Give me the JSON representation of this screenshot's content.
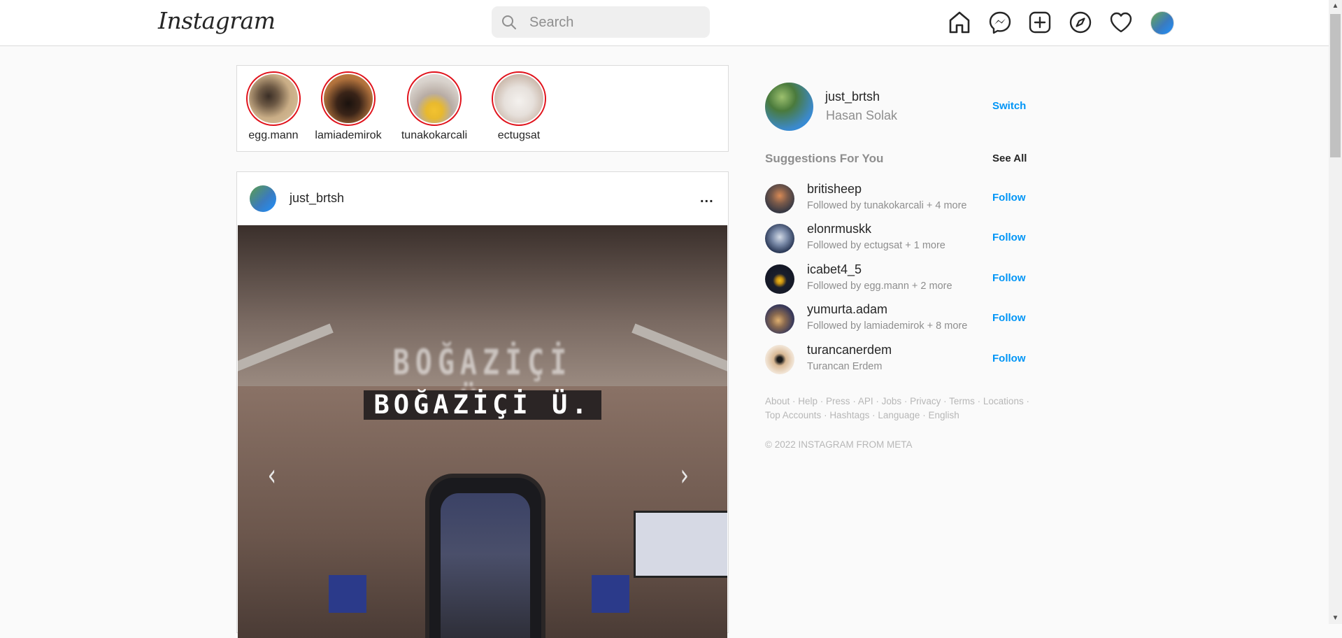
{
  "app": {
    "logo_text": "Instagram"
  },
  "search": {
    "placeholder": "Search",
    "value": ""
  },
  "nav": {
    "icons": [
      "home-icon",
      "messenger-icon",
      "new-post-icon",
      "explore-icon",
      "activity-heart-icon",
      "profile-avatar"
    ]
  },
  "stories": [
    {
      "username": "egg.mann"
    },
    {
      "username": "lamiademirok"
    },
    {
      "username": "tunakokarcali"
    },
    {
      "username": "ectugsat"
    }
  ],
  "post": {
    "username": "just_brtsh",
    "more_label": "...",
    "image_sign_text": "BOĞAZİÇİ Ü.",
    "prev_arrow": "‹",
    "next_arrow": "›"
  },
  "profile": {
    "username": "just_brtsh",
    "full_name": "Hasan Solak",
    "switch_label": "Switch"
  },
  "suggestions": {
    "title": "Suggestions For You",
    "see_all_label": "See All",
    "follow_label": "Follow",
    "items": [
      {
        "username": "britisheep",
        "subtitle": "Followed by tunakokarcali + 4 more"
      },
      {
        "username": "elonrmuskk",
        "subtitle": "Followed by ectugsat + 1 more"
      },
      {
        "username": "icabet4_5",
        "subtitle": "Followed by egg.mann + 2 more"
      },
      {
        "username": "yumurta.adam",
        "subtitle": "Followed by lamiademirok + 8 more"
      },
      {
        "username": "turancanerdem",
        "subtitle": "Turancan Erdem"
      }
    ]
  },
  "footer": {
    "links_line1": [
      "About",
      "Help",
      "Press",
      "API",
      "Jobs",
      "Privacy",
      "Terms",
      "Locations"
    ],
    "links_line2": [
      "Top Accounts",
      "Hashtags",
      "Language",
      "English"
    ],
    "copyright": "© 2022 INSTAGRAM FROM META"
  },
  "colors": {
    "accent": "#0095f6",
    "story_ring": "#e0121b",
    "muted_text": "#8e8e8e",
    "border": "#dbdbdb"
  }
}
